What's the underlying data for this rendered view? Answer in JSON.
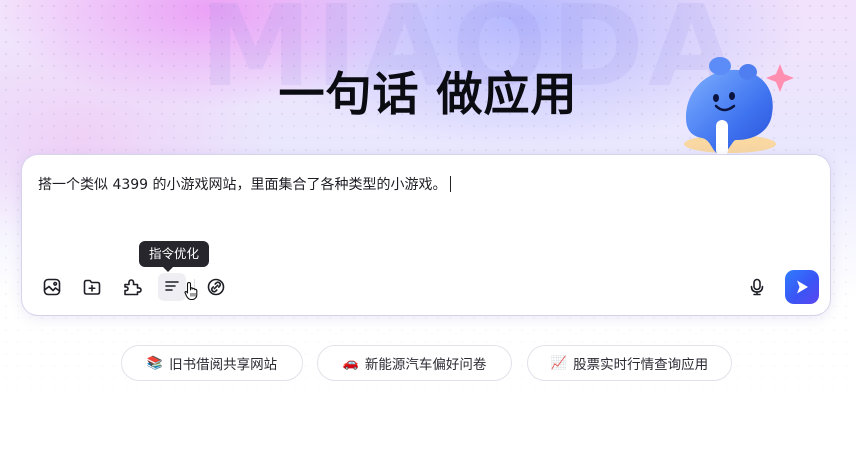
{
  "hero": {
    "watermark": "MIAODA",
    "title": "一句话 做应用"
  },
  "composer": {
    "prompt_text": "搭一个类似 4399 的小游戏网站，里面集合了各种类型的小游戏。",
    "tooltip": "指令优化",
    "tools": [
      {
        "icon": "image-icon"
      },
      {
        "icon": "folder-add-icon"
      },
      {
        "icon": "plugin-icon"
      },
      {
        "icon": "prompt-optimize-icon"
      },
      {
        "icon": "link-icon"
      }
    ],
    "mic_icon": "microphone-icon",
    "send_icon": "send-icon",
    "accent": "#3a55f5"
  },
  "suggestions": [
    {
      "emoji": "📚",
      "label": "旧书借阅共享网站"
    },
    {
      "emoji": "🚗",
      "label": "新能源汽车偏好问卷"
    },
    {
      "emoji": "📈",
      "label": "股票实时行情查询应用"
    }
  ]
}
